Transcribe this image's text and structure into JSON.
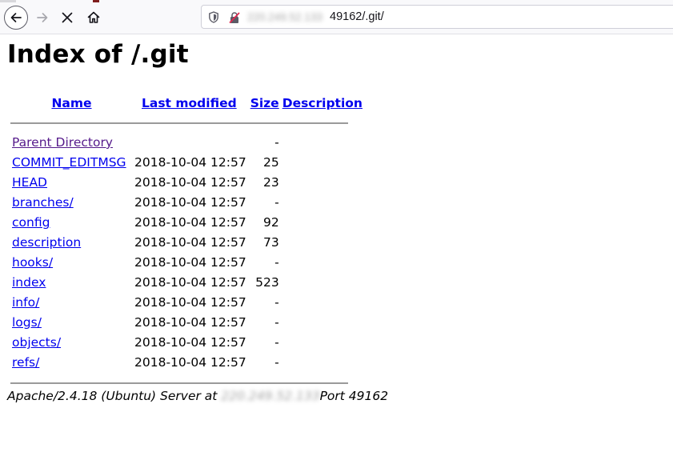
{
  "browser": {
    "url_host": "220.249.52.133",
    "url_rest": "49162/.git/"
  },
  "page": {
    "title": "Index of /.git",
    "columns": {
      "name": "Name",
      "last_modified": "Last modified",
      "size": "Size",
      "description": "Description"
    },
    "parent": {
      "name": "Parent Directory",
      "size": "-"
    },
    "rows": [
      {
        "name": "COMMIT_EDITMSG",
        "modified": "2018-10-04 12:57",
        "size": "25"
      },
      {
        "name": "HEAD",
        "modified": "2018-10-04 12:57",
        "size": "23"
      },
      {
        "name": "branches/",
        "modified": "2018-10-04 12:57",
        "size": "-"
      },
      {
        "name": "config",
        "modified": "2018-10-04 12:57",
        "size": "92"
      },
      {
        "name": "description",
        "modified": "2018-10-04 12:57",
        "size": "73"
      },
      {
        "name": "hooks/",
        "modified": "2018-10-04 12:57",
        "size": "-"
      },
      {
        "name": "index",
        "modified": "2018-10-04 12:57",
        "size": "523"
      },
      {
        "name": "info/",
        "modified": "2018-10-04 12:57",
        "size": "-"
      },
      {
        "name": "logs/",
        "modified": "2018-10-04 12:57",
        "size": "-"
      },
      {
        "name": "objects/",
        "modified": "2018-10-04 12:57",
        "size": "-"
      },
      {
        "name": "refs/",
        "modified": "2018-10-04 12:57",
        "size": "-"
      }
    ],
    "footer": {
      "server": "Apache/2.4.18 (Ubuntu) Server at ",
      "host": "220.249.52.133",
      "port": "Port 49162"
    }
  },
  "icons": {
    "back": "back-arrow-icon",
    "forward": "forward-arrow-icon",
    "stop": "stop-icon",
    "home": "home-icon",
    "shield": "shield-icon",
    "lock": "insecure-lock-icon"
  },
  "colors": {
    "link": "#0000ee",
    "visited": "#551a8b"
  }
}
